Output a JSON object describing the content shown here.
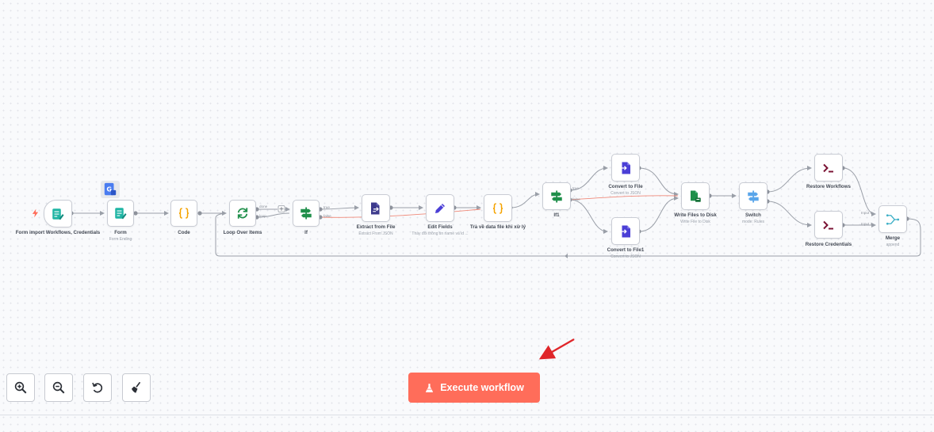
{
  "colors": {
    "accent": "#ff6d5a",
    "connection": "#9a9fa8",
    "error_connection": "#f08a7a",
    "teal": "#1fb5a4",
    "green": "#1f8f4a",
    "indigo": "#4b3fd6",
    "orange": "#f5a300",
    "maroon": "#7a1233"
  },
  "nodes": {
    "form_import": {
      "label": "Form import Workflows, Credentials",
      "icon": "form-icon"
    },
    "form": {
      "label": "Form",
      "sub": "Form Ending",
      "icon": "form-icon"
    },
    "code": {
      "label": "Code",
      "icon": "code-braces-icon"
    },
    "loop": {
      "label": "Loop Over Items",
      "icon": "loop-arrows-icon",
      "port_top": "done",
      "port_bottom": "loop"
    },
    "if_node": {
      "label": "If",
      "icon": "if-signpost-icon",
      "port_top": "true",
      "port_bottom": "false"
    },
    "extract": {
      "label": "Extract from File",
      "sub": "Extract From JSON",
      "icon": "file-extract-icon"
    },
    "edit_fields": {
      "label": "Edit Fields",
      "sub": "Thay đổi thông tin name và id ...",
      "icon": "pencil-icon"
    },
    "tra_ve": {
      "label": "Trả về data file khi xử lý",
      "icon": "code-braces-icon"
    },
    "if1": {
      "label": "If1",
      "icon": "if-signpost-icon",
      "port_top": "true",
      "port_bottom": "false"
    },
    "convert_file": {
      "label": "Convert to File",
      "sub": "Convert to JSON",
      "icon": "file-convert-icon"
    },
    "convert_file1": {
      "label": "Convert to File1",
      "sub": "Convert to JSON",
      "icon": "file-convert-icon"
    },
    "write_files": {
      "label": "Write Files to Disk",
      "sub": "Write File to Disk",
      "icon": "file-write-icon"
    },
    "switch_node": {
      "label": "Switch",
      "sub": "mode: Rules",
      "icon": "switch-signpost-icon"
    },
    "restore_workflows": {
      "label": "Restore Workflows",
      "icon": "terminal-icon"
    },
    "restore_credentials": {
      "label": "Restore Credentials",
      "icon": "terminal-icon"
    },
    "merge": {
      "label": "Merge",
      "sub": "append",
      "icon": "merge-icon",
      "port_top": "Input 1",
      "port_bottom": "Input 2"
    }
  },
  "toolbar": {
    "zoom_in": "zoom-in-icon",
    "zoom_out": "zoom-out-icon",
    "reset": "reset-zoom-icon",
    "tidy": "broom-icon"
  },
  "execute": {
    "label": "Execute workflow",
    "icon": "flask-icon"
  }
}
